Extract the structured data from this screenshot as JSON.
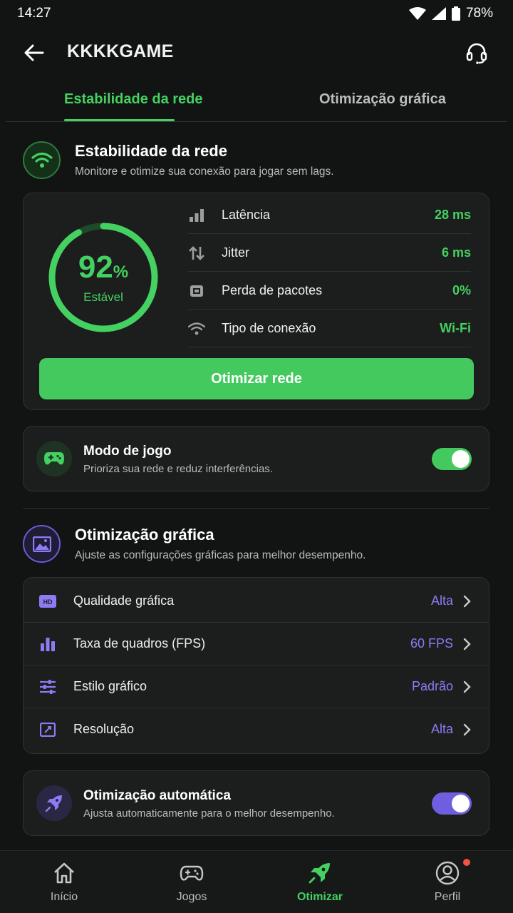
{
  "status_bar": {
    "time": "14:27",
    "battery": "78%"
  },
  "header": {
    "title": "KKKKGAME"
  },
  "tabs": [
    {
      "label": "Estabilidade da rede",
      "active": true
    },
    {
      "label": "Otimização gráfica",
      "active": false
    }
  ],
  "network": {
    "title": "Estabilidade da rede",
    "subtitle": "Monitore e otimize sua conexão para jogar sem lags.",
    "score": "92",
    "score_unit": "%",
    "score_fraction": 0.92,
    "status": "Estável",
    "metrics": [
      {
        "icon": "signal-bars-icon",
        "label": "Latência",
        "value": "28 ms"
      },
      {
        "icon": "up-down-arrows-icon",
        "label": "Jitter",
        "value": "6 ms"
      },
      {
        "icon": "packet-chip-icon",
        "label": "Perda de pacotes",
        "value": "0%"
      },
      {
        "icon": "wifi-icon",
        "label": "Tipo de conexão",
        "value": "Wi-Fi"
      }
    ],
    "button_label": "Otimizar rede"
  },
  "game_mode": {
    "title": "Modo de jogo",
    "subtitle": "Prioriza sua rede e reduz interferências.",
    "enabled": true
  },
  "graphics": {
    "title": "Otimização gráfica",
    "subtitle": "Ajuste as configurações gráficas para melhor desempenho.",
    "settings": [
      {
        "icon": "hd-icon",
        "label": "Qualidade gráfica",
        "value": "Alta"
      },
      {
        "icon": "bar-chart-icon",
        "label": "Taxa de quadros (FPS)",
        "value": "60 FPS"
      },
      {
        "icon": "sliders-icon",
        "label": "Estilo gráfico",
        "value": "Padrão"
      },
      {
        "icon": "resolution-icon",
        "label": "Resolução",
        "value": "Alta"
      }
    ]
  },
  "auto_optimize": {
    "title": "Otimização automática",
    "subtitle": "Ajusta automaticamente para o melhor desempenho.",
    "enabled": true
  },
  "nav": [
    {
      "icon": "home-icon",
      "label": "Início",
      "active": false
    },
    {
      "icon": "gamepad-icon",
      "label": "Jogos",
      "active": false
    },
    {
      "icon": "rocket-icon",
      "label": "Otimizar",
      "active": true
    },
    {
      "icon": "profile-icon",
      "label": "Perfil",
      "active": false,
      "badge": true
    }
  ],
  "colors": {
    "background": "#121413",
    "card": "#1b1e1c",
    "accent_green": "#44d161",
    "accent_purple": "#8b7cf6",
    "badge_red": "#f0553f"
  }
}
